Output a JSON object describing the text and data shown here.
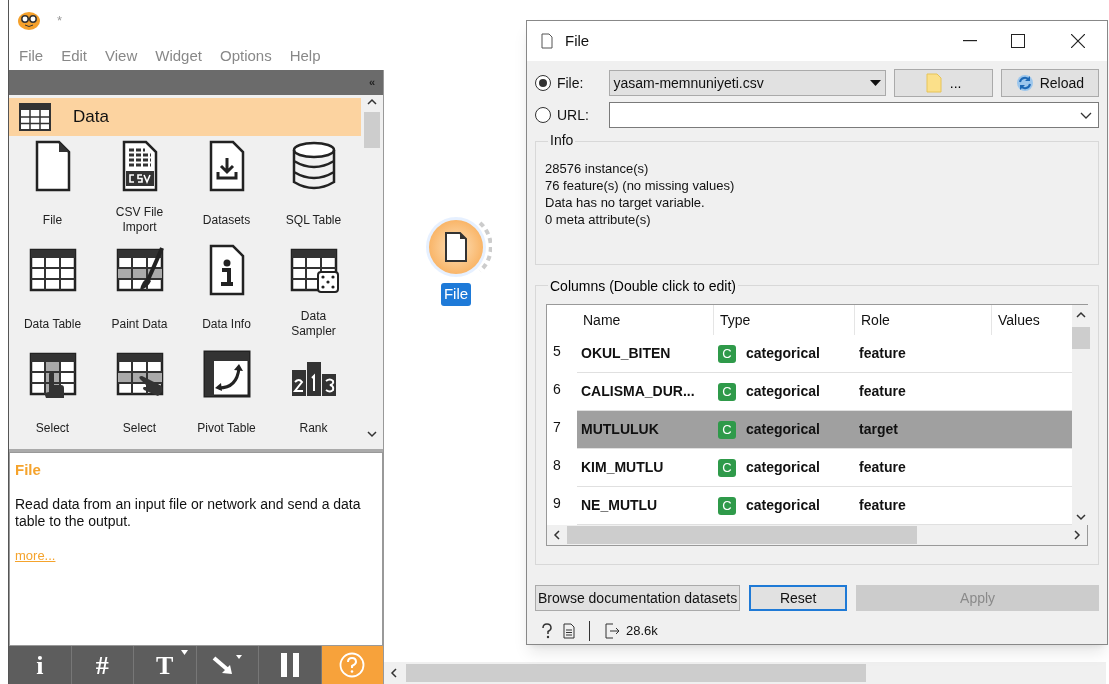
{
  "app": {
    "title": "*",
    "menu": [
      "File",
      "Edit",
      "View",
      "Widget",
      "Options",
      "Help"
    ]
  },
  "toolbox": {
    "collapse": "«",
    "category": {
      "label": "Data"
    },
    "widgets": [
      {
        "kind": "file",
        "label": "File"
      },
      {
        "kind": "csv",
        "label": "CSV File Import"
      },
      {
        "kind": "datasets",
        "label": "Datasets"
      },
      {
        "kind": "sql",
        "label": "SQL Table"
      },
      {
        "kind": "table",
        "label": "Data Table"
      },
      {
        "kind": "paint",
        "label": "Paint Data"
      },
      {
        "kind": "info",
        "label": "Data Info"
      },
      {
        "kind": "sampler",
        "label": "Data Sampler"
      },
      {
        "kind": "select-cols",
        "label": "Select"
      },
      {
        "kind": "select-rows",
        "label": "Select"
      },
      {
        "kind": "pivot",
        "label": "Pivot Table"
      },
      {
        "kind": "rank",
        "label": "Rank"
      }
    ]
  },
  "help": {
    "title": "File",
    "text": "Read data from an input file or network and send a data table to the output.",
    "link": "more..."
  },
  "toolbar": [
    {
      "kind": "text",
      "label": "i",
      "on": false
    },
    {
      "kind": "text",
      "label": "#",
      "on": false
    },
    {
      "kind": "text-menu",
      "label": "T",
      "on": false
    },
    {
      "kind": "arrow",
      "on": false
    },
    {
      "kind": "pause",
      "on": false
    },
    {
      "kind": "help",
      "on": true
    }
  ],
  "canvas": {
    "nodes": [
      {
        "label": "File",
        "selected": true
      }
    ]
  },
  "dialog": {
    "title": "File",
    "sources": [
      {
        "label": "File:",
        "selected": true,
        "value": "yasam-memnuniyeti.csv"
      },
      {
        "label": "URL:",
        "selected": false
      }
    ],
    "browse_label": "...",
    "reload_label": "Reload",
    "info": {
      "title": "Info",
      "lines": [
        "28576 instance(s)",
        "76 feature(s) (no missing values)",
        "Data has no target variable.",
        "0 meta attribute(s)"
      ]
    },
    "columns": {
      "title": "Columns (Double click to edit)",
      "headers": [
        "Name",
        "Type",
        "Role",
        "Values"
      ],
      "rows": [
        {
          "index": "5",
          "name": "OKUL_BITEN",
          "type_icon": "C",
          "type": "categorical",
          "role": "feature",
          "selected": false
        },
        {
          "index": "6",
          "name": "CALISMA_DUR...",
          "type_icon": "C",
          "type": "categorical",
          "role": "feature",
          "selected": false
        },
        {
          "index": "7",
          "name": "MUTLULUK",
          "type_icon": "C",
          "type": "categorical",
          "role": "target",
          "selected": true
        },
        {
          "index": "8",
          "name": "KIM_MUTLU",
          "type_icon": "C",
          "type": "categorical",
          "role": "feature",
          "selected": false
        },
        {
          "index": "9",
          "name": "NE_MUTLU",
          "type_icon": "C",
          "type": "categorical",
          "role": "feature",
          "selected": false
        }
      ]
    },
    "buttons": [
      {
        "label": "Browse documentation datasets",
        "kind": "normal"
      },
      {
        "label": "Reset",
        "kind": "focused"
      },
      {
        "label": "Apply",
        "kind": "disabled"
      }
    ],
    "status": {
      "output": "28.6k"
    }
  }
}
